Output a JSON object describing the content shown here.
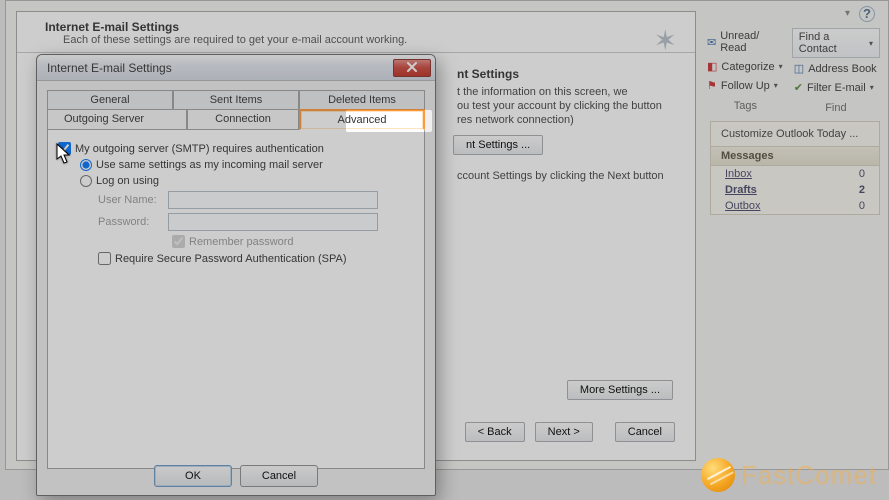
{
  "bg": {
    "banner_title": "Internet E-mail Settings",
    "banner_sub": "Each of these settings are required to get your e-mail account working.",
    "section_heading": "nt Settings",
    "line1": "t the information on this screen, we",
    "line2": "ou test your account by clicking the button",
    "line3": "res network connection)",
    "test_btn": "nt Settings ...",
    "after_next": "ccount Settings by clicking the Next button",
    "more_settings": "More Settings ...",
    "back": "< Back",
    "next": "Next >",
    "cancel": "Cancel"
  },
  "ribbon": {
    "unread": "Unread/ Read",
    "categorize": "Categorize",
    "followup": "Follow Up",
    "tags_label": "Tags",
    "find_contact": "Find a Contact",
    "address_book": "Address Book",
    "filter": "Filter E-mail",
    "find_label": "Find"
  },
  "panel": {
    "title": "Customize Outlook Today ...",
    "messages": "Messages",
    "rows": [
      {
        "label": "Inbox",
        "value": "0"
      },
      {
        "label": "Drafts",
        "value": "2"
      },
      {
        "label": "Outbox",
        "value": "0"
      }
    ]
  },
  "modal": {
    "title": "Internet E-mail Settings",
    "tabs_row1": [
      "General",
      "Sent Items",
      "Deleted Items"
    ],
    "tabs_row2": [
      "Outgoing Server",
      "Connection",
      "Advanced"
    ],
    "smtp_auth": "My outgoing server (SMTP) requires authentication",
    "use_same": "Use same settings as my incoming mail server",
    "log_on": "Log on using",
    "user_name": "User Name:",
    "password": "Password:",
    "remember": "Remember password",
    "require_spa": "Require Secure Password Authentication (SPA)",
    "ok": "OK",
    "cancel": "Cancel"
  },
  "watermark": "FastComet"
}
